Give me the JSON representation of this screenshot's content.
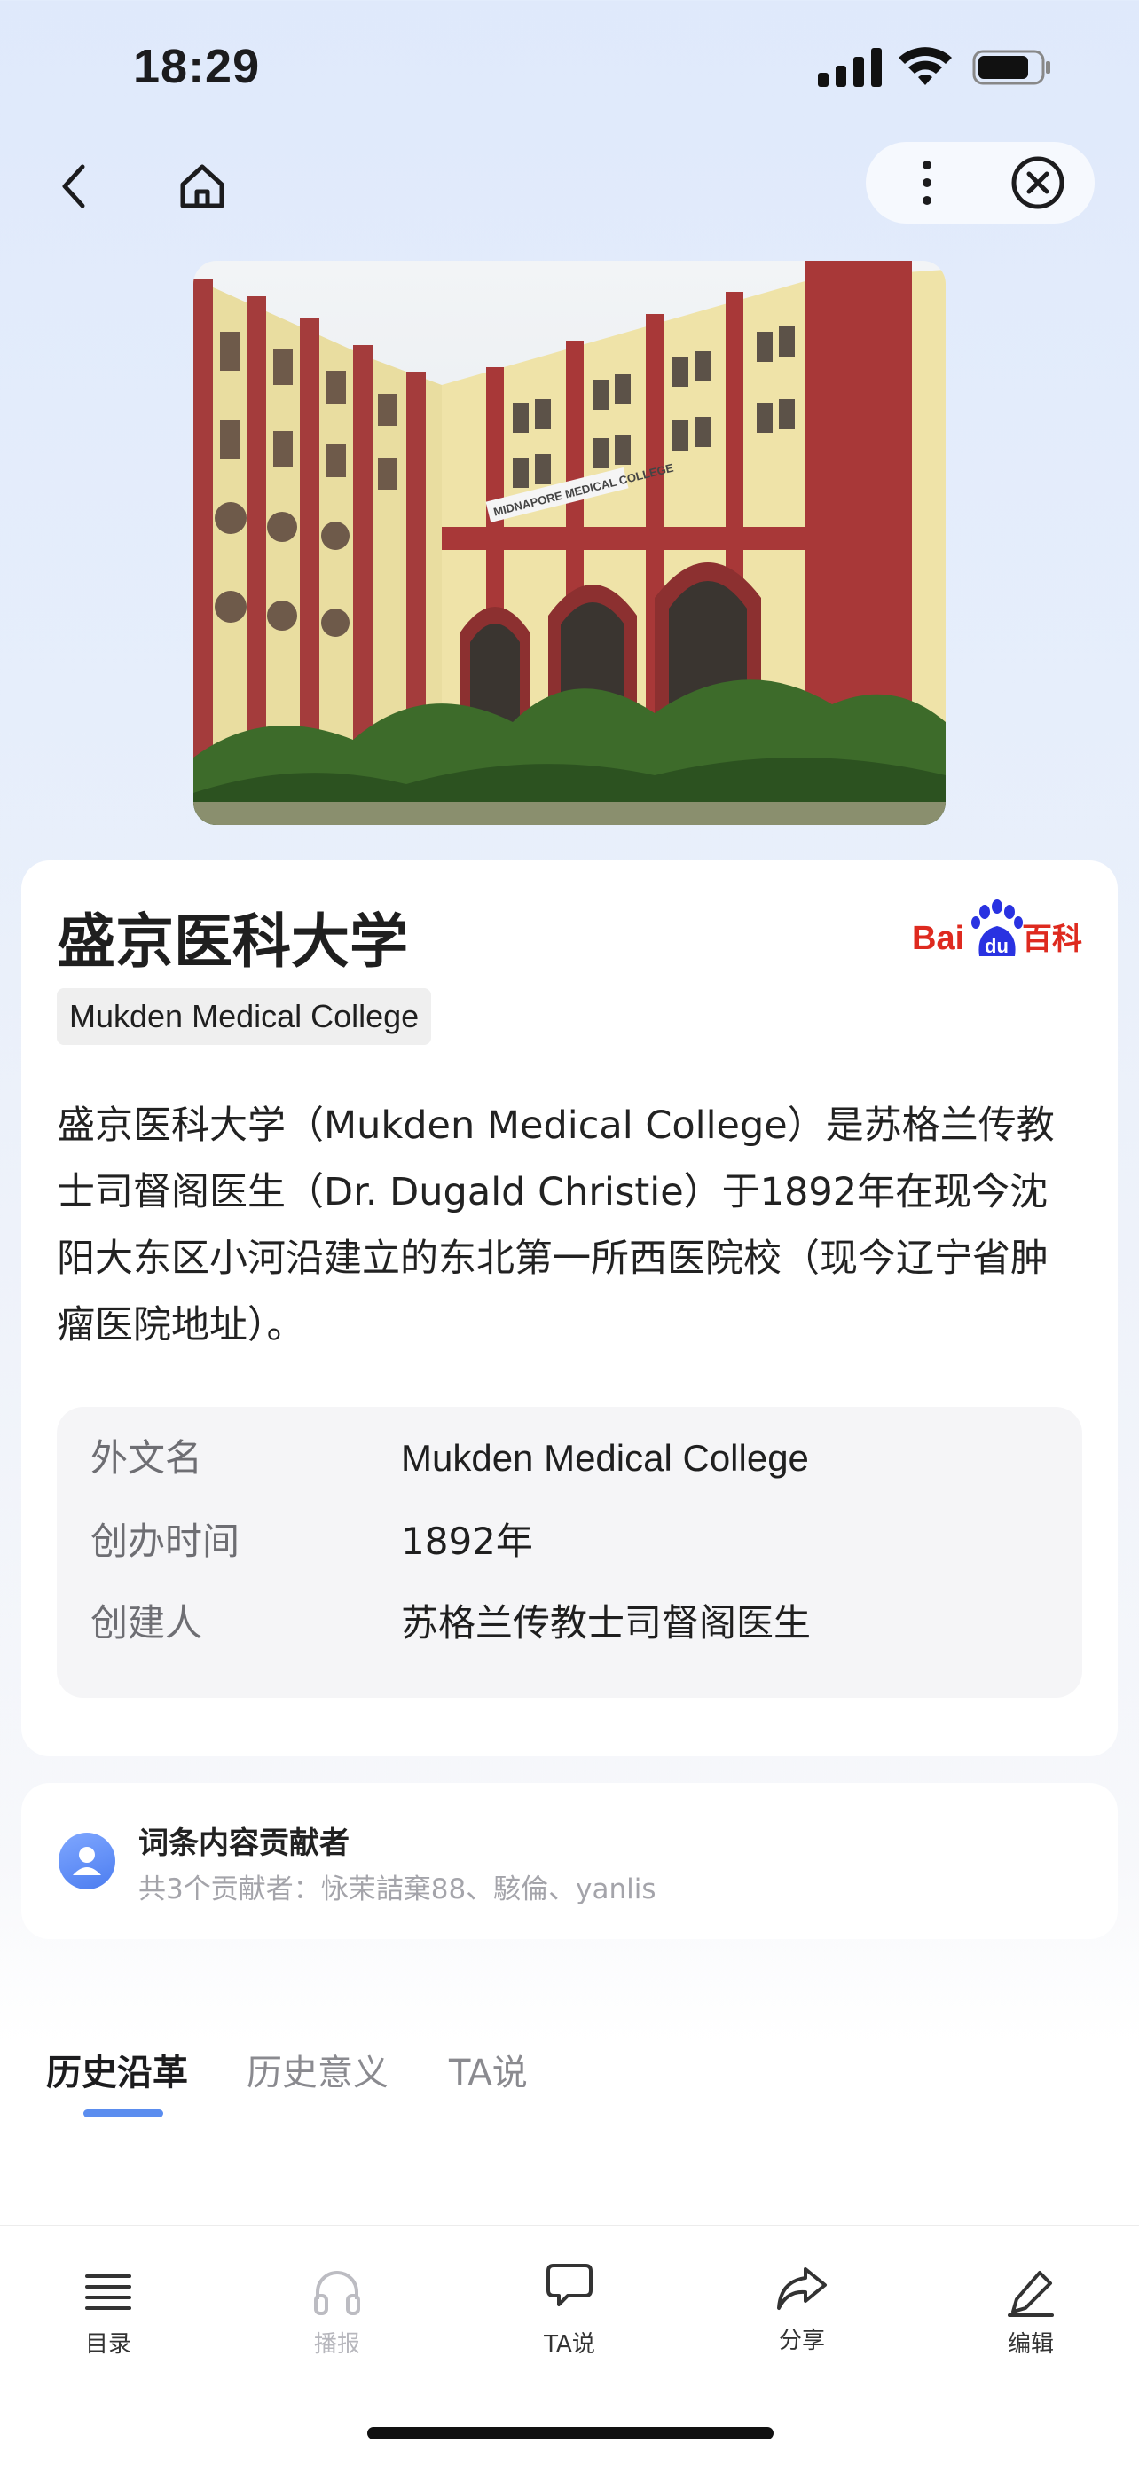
{
  "status_bar": {
    "time": "18:29"
  },
  "hero": {
    "sign_text": "MIDNAPORE MEDICAL COLLEGE"
  },
  "entry": {
    "title": "盛京医科大学",
    "logo_text_left": "Bai",
    "logo_text_du": "du",
    "logo_text_right": "百科",
    "english_name": "Mukden Medical College",
    "description": "盛京医科大学（Mukden Medical College）是苏格兰传教士司督阁医生（Dr. Dugald Christie）于1892年在现今沈阳大东区小河沿建立的东北第一所西医院校（现今辽宁省肿瘤医院地址）。",
    "info": [
      {
        "key": "外文名",
        "value": "Mukden Medical College"
      },
      {
        "key": "创办时间",
        "value": "1892年"
      },
      {
        "key": "创建人",
        "value": "苏格兰传教士司督阁医生"
      }
    ]
  },
  "contributors": {
    "title": "词条内容贡献者",
    "subtitle": "共3个贡献者：怺茉詰棄88、駭倫、yanlis"
  },
  "tabs": [
    {
      "label": "历史沿革",
      "active": true
    },
    {
      "label": "历史意义",
      "active": false
    },
    {
      "label": "TA说",
      "active": false
    }
  ],
  "bottom_bar": [
    {
      "label": "目录",
      "icon": "list-icon"
    },
    {
      "label": "播报",
      "icon": "headphones-icon",
      "disabled": true
    },
    {
      "label": "TA说",
      "icon": "chat-bubble-icon"
    },
    {
      "label": "分享",
      "icon": "share-icon"
    },
    {
      "label": "编辑",
      "icon": "edit-pen-icon"
    }
  ],
  "colors": {
    "accent": "#5b8def",
    "baidu_red": "#de2a1f",
    "baidu_blue": "#2932e1"
  }
}
